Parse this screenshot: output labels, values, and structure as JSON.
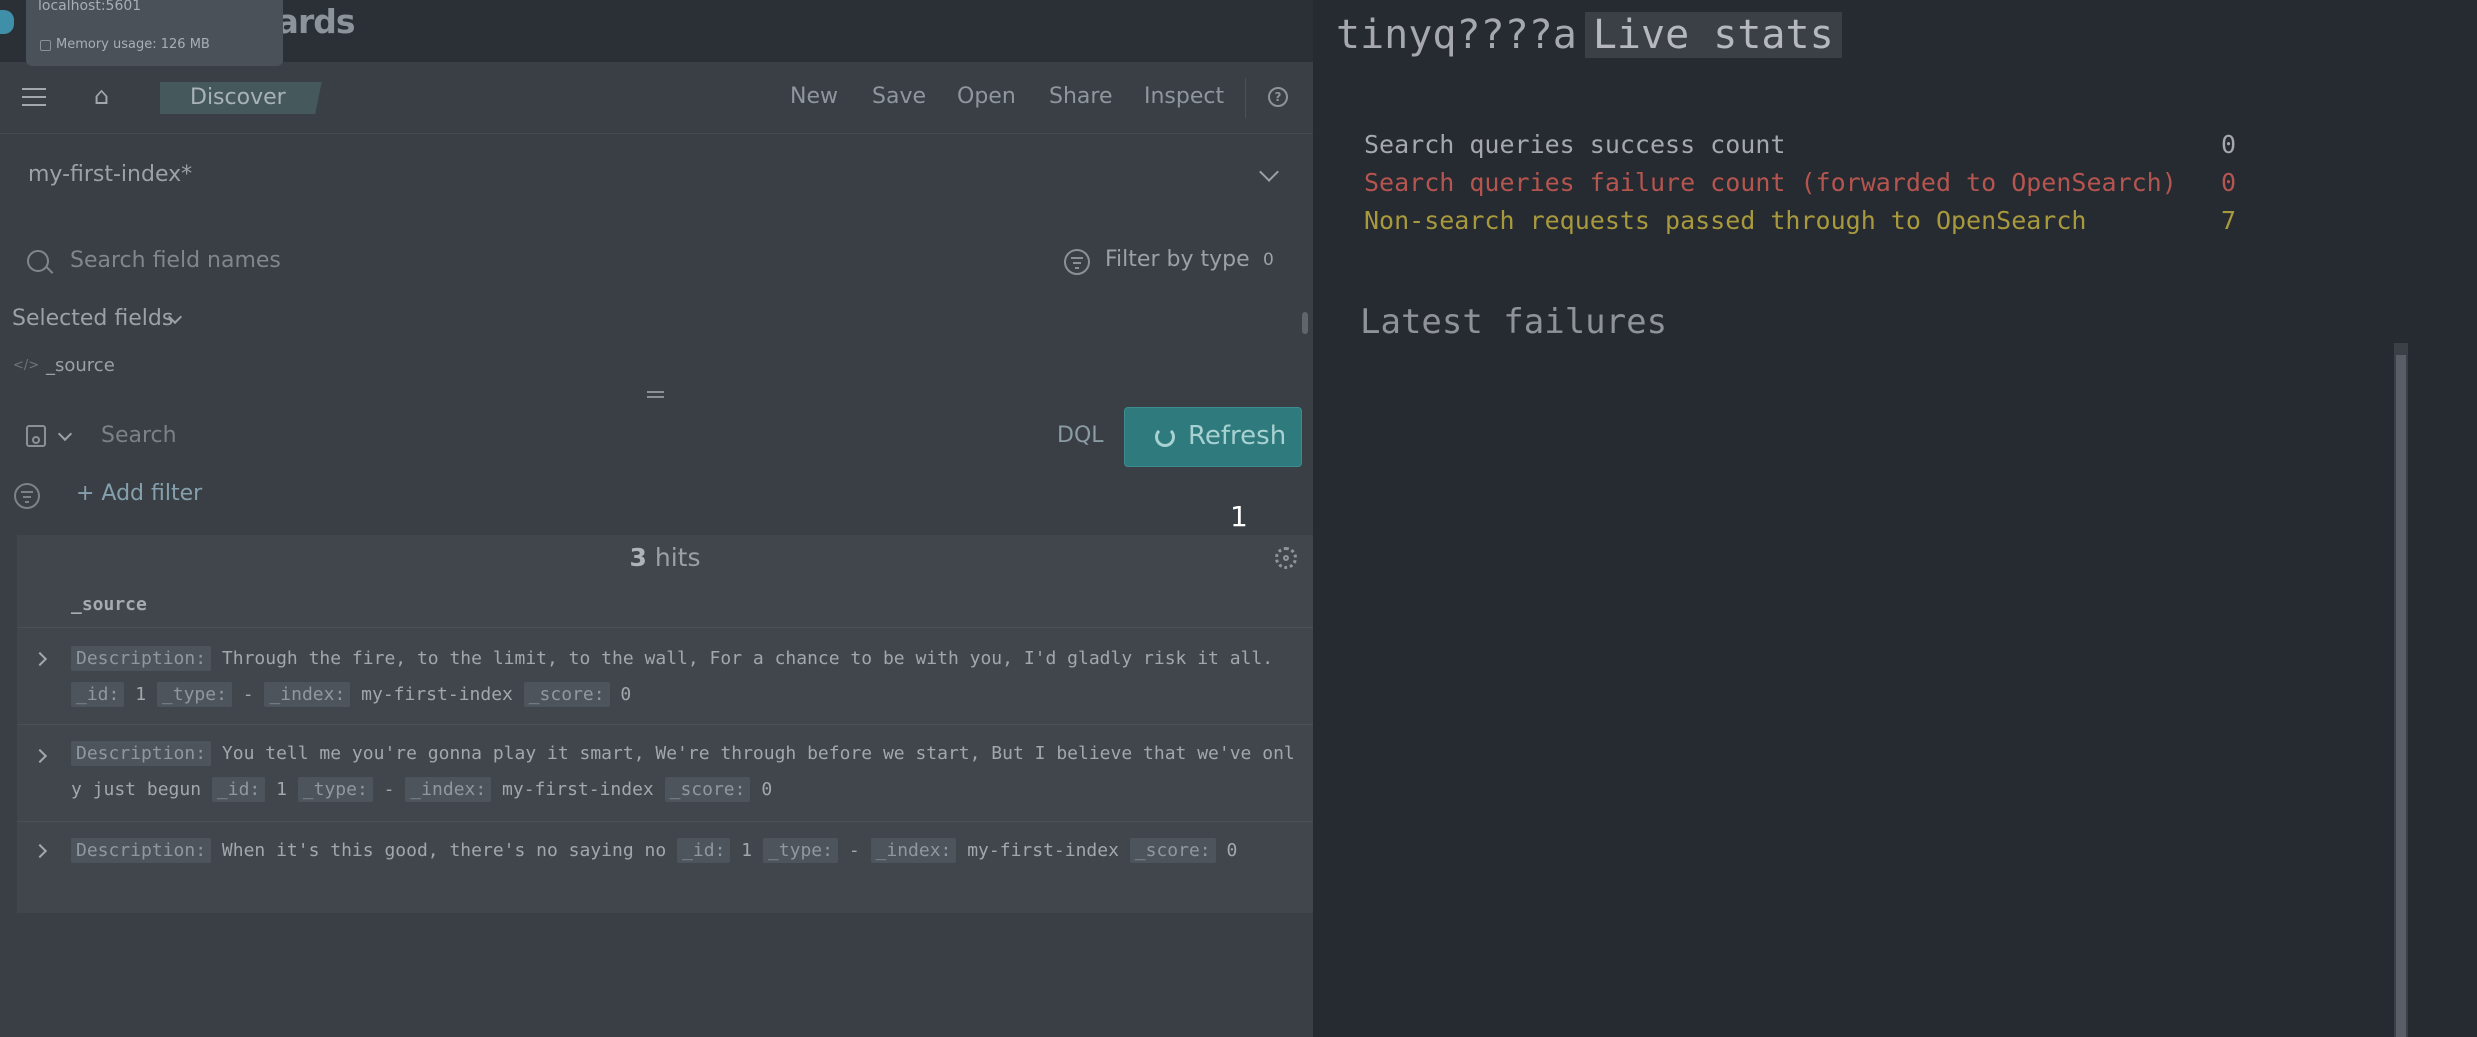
{
  "browser_overlay": {
    "url": "localhost:5601",
    "memory": "Memory usage: 126 MB"
  },
  "brand": {
    "text": "oards"
  },
  "nav": {
    "breadcrumb": "Discover",
    "menu": [
      "New",
      "Save",
      "Open",
      "Share",
      "Inspect"
    ]
  },
  "sidebar": {
    "index_pattern": "my-first-index*",
    "search_placeholder": "Search field names",
    "filter_by_type": "Filter by type",
    "filter_count": "0",
    "selected_fields_label": "Selected fields",
    "fields": [
      "_source"
    ]
  },
  "query_bar": {
    "placeholder": "Search",
    "language": "DQL",
    "refresh_label": "Refresh",
    "add_filter": "+ Add filter"
  },
  "results": {
    "hits_count": "3",
    "hits_label": "hits",
    "column": "_source",
    "marker": "1",
    "rows": [
      {
        "line1": [
          {
            "k": "Description:",
            "v": "Through the fire, to the limit, to the wall, For a chance to be with you, I'd gladly risk it all."
          }
        ],
        "line2": [
          {
            "k": "_id:",
            "v": "1"
          },
          {
            "k": "_type:",
            "v": "-"
          },
          {
            "k": "_index:",
            "v": "my-first-index"
          },
          {
            "k": "_score:",
            "v": "0"
          }
        ]
      },
      {
        "line1": [
          {
            "k": "Description:",
            "v": "You tell me you're gonna play it smart, We're through before we start, But I believe that we've onl"
          }
        ],
        "line2_prefix": "y just begun",
        "line2": [
          {
            "k": "_id:",
            "v": "1"
          },
          {
            "k": "_type:",
            "v": "-"
          },
          {
            "k": "_index:",
            "v": "my-first-index"
          },
          {
            "k": "_score:",
            "v": "0"
          }
        ]
      },
      {
        "line1": [
          {
            "k": "Description:",
            "v": "When it's this good, there's no saying no"
          },
          {
            "k": "_id:",
            "v": "1"
          },
          {
            "k": "_type:",
            "v": "-"
          },
          {
            "k": "_index:",
            "v": "my-first-index"
          },
          {
            "k": "_score:",
            "v": "0"
          }
        ]
      }
    ]
  },
  "live_stats": {
    "app_name": "tinyq????a",
    "title": "Live stats",
    "stats": [
      {
        "label": "Search queries success count",
        "value": "0",
        "color": "#a5a8ad"
      },
      {
        "label": "Search queries failure count (forwarded to OpenSearch)",
        "value": "0",
        "color": "#b5554f"
      },
      {
        "label": "Non-search requests passed through to OpenSearch",
        "value": "7",
        "color": "#a89a3c"
      }
    ],
    "latest_failures": "Latest failures"
  }
}
